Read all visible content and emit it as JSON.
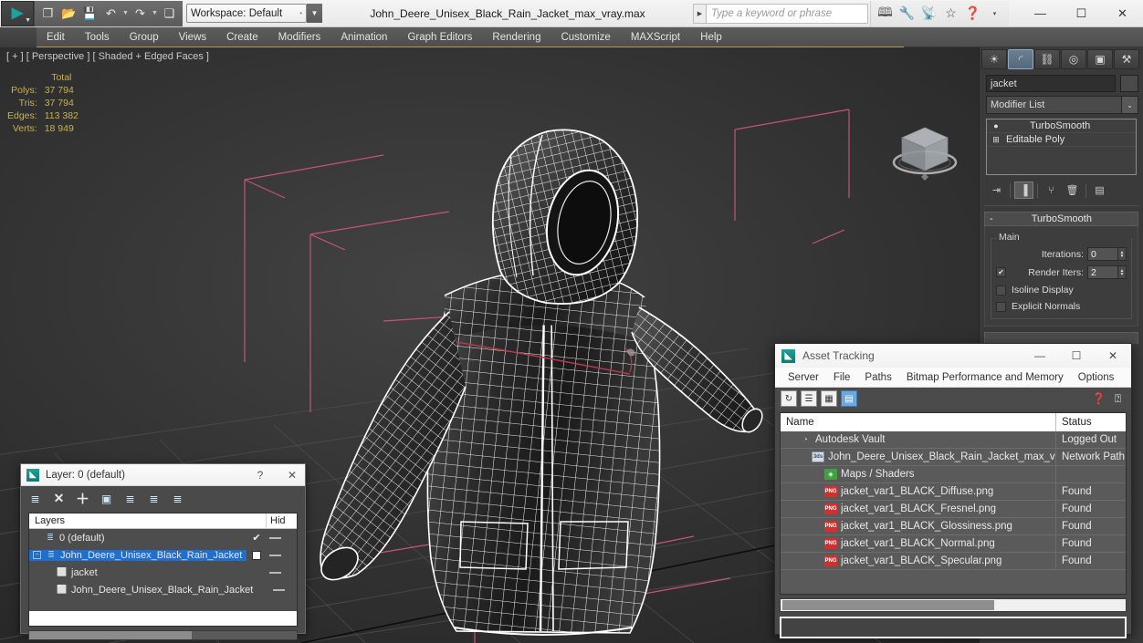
{
  "titlebar": {
    "logo_glyph": "▶",
    "quick_access": [
      {
        "name": "new-file-icon",
        "glyph": "❐"
      },
      {
        "name": "open-file-icon",
        "glyph": "📂"
      },
      {
        "name": "save-file-icon",
        "glyph": "💾"
      },
      {
        "name": "undo-icon",
        "glyph": "↶"
      },
      {
        "name": "undo-dropdown-icon",
        "glyph": "▼"
      },
      {
        "name": "redo-icon",
        "glyph": "↷"
      },
      {
        "name": "redo-dropdown-icon",
        "glyph": "▼"
      },
      {
        "name": "project-folder-icon",
        "glyph": "❑"
      }
    ],
    "workspace_label": "Workspace: Default",
    "workspace_sep": "•",
    "workspace_dropdown": "▼",
    "document_title": "John_Deere_Unisex_Black_Rain_Jacket_max_vray.max",
    "search_arrow": "▶",
    "search_placeholder": "Type a keyword or phrase",
    "right_icons": [
      {
        "name": "binoculars-icon",
        "glyph": "🕮"
      },
      {
        "name": "wrench-icon",
        "glyph": "🔧"
      },
      {
        "name": "satellite-dish-icon",
        "glyph": "📡"
      },
      {
        "name": "star-icon",
        "glyph": "☆"
      },
      {
        "name": "help-icon",
        "glyph": "❓"
      },
      {
        "name": "help-dropdown-icon",
        "glyph": "▾"
      }
    ],
    "window_buttons": [
      {
        "name": "minimize-button",
        "glyph": "—"
      },
      {
        "name": "maximize-button",
        "glyph": "☐"
      },
      {
        "name": "close-button",
        "glyph": "✕"
      }
    ]
  },
  "menubar": {
    "items": [
      "Edit",
      "Tools",
      "Group",
      "Views",
      "Create",
      "Modifiers",
      "Animation",
      "Graph Editors",
      "Rendering",
      "Customize",
      "MAXScript",
      "Help"
    ]
  },
  "viewport": {
    "label": "[ + ] [ Perspective ] [ Shaded + Edged Faces ]",
    "stats": {
      "header": "Total",
      "rows": [
        {
          "key": "Polys:",
          "value": "37 794"
        },
        {
          "key": "Tris:",
          "value": "37 794"
        },
        {
          "key": "Edges:",
          "value": "113 382"
        },
        {
          "key": "Verts:",
          "value": "18 949"
        }
      ]
    },
    "colors": {
      "background": "#323232",
      "helper_lines": "#cc5577",
      "grid": "#4a4a4a",
      "wireframe": "#ffffff"
    }
  },
  "command_panel": {
    "tabs": [
      {
        "name": "create-tab",
        "glyph": "☀",
        "active": false
      },
      {
        "name": "modify-tab",
        "glyph": "◜",
        "active": true
      },
      {
        "name": "hierarchy-tab",
        "glyph": "⛓",
        "active": false
      },
      {
        "name": "motion-tab",
        "glyph": "◎",
        "active": false
      },
      {
        "name": "display-tab",
        "glyph": "▣",
        "active": false
      },
      {
        "name": "utilities-tab",
        "glyph": "⚒",
        "active": false
      }
    ],
    "object_name": "jacket",
    "modifier_list_label": "Modifier List",
    "modifier_list_arrow": "⌄",
    "modifier_stack": [
      {
        "label": "TurboSmooth",
        "icon": "lightbulb-icon",
        "glyph": "●"
      },
      {
        "label": "Editable Poly",
        "icon": "plus-box-icon",
        "glyph": "⊞"
      }
    ],
    "stack_tools": [
      {
        "name": "pin-stack-icon",
        "glyph": "⇥"
      },
      {
        "name": "show-end-result-icon",
        "glyph": "▐"
      },
      {
        "name": "make-unique-icon",
        "glyph": "⑂"
      },
      {
        "name": "remove-modifier-icon",
        "glyph": "🗑"
      },
      {
        "name": "configure-sets-icon",
        "glyph": "▤"
      }
    ],
    "rollout": {
      "collapse_glyph": "-",
      "title": "TurboSmooth",
      "group_title": "Main",
      "iterations_label": "Iterations:",
      "iterations_value": "0",
      "render_iters_label": "Render Iters:",
      "render_iters_value": "2",
      "render_iters_checked": "✔",
      "isoline_label": "Isoline Display",
      "explicit_normals_label": "Explicit Normals"
    }
  },
  "layer_dialog": {
    "title": "Layer: 0 (default)",
    "help_glyph": "?",
    "close_glyph": "✕",
    "toolbar": [
      {
        "name": "new-layer-icon",
        "glyph": "≣"
      },
      {
        "name": "delete-layer-icon",
        "glyph": "✕"
      },
      {
        "name": "add-layer-icon",
        "glyph": "＋"
      },
      {
        "name": "select-objects-in-layer-icon",
        "glyph": "▣"
      },
      {
        "name": "select-highlighted-objects-icon",
        "glyph": "≣"
      },
      {
        "name": "add-selection-to-layer-icon",
        "glyph": "≣"
      },
      {
        "name": "layer-settings-icon",
        "glyph": "≣"
      }
    ],
    "col_name": "Layers",
    "col_hide": "Hid",
    "rows": [
      {
        "label": "0 (default)",
        "indent": 1,
        "selected": false,
        "icon": "layer-icon",
        "glyph": "≣",
        "check": "✔",
        "box": false,
        "dash": true
      },
      {
        "label": "John_Deere_Unisex_Black_Rain_Jacket",
        "indent": 0,
        "selected": true,
        "icon": "layer-icon",
        "glyph": "≣",
        "check": "",
        "box": true,
        "dash": true,
        "expander": "−"
      },
      {
        "label": "jacket",
        "indent": 2,
        "selected": false,
        "icon": "object-icon",
        "glyph": "⬜",
        "check": "",
        "box": false,
        "dash": true
      },
      {
        "label": "John_Deere_Unisex_Black_Rain_Jacket",
        "indent": 2,
        "selected": false,
        "icon": "object-icon",
        "glyph": "⬜",
        "check": "",
        "box": false,
        "dash": true
      }
    ]
  },
  "asset_tracking": {
    "title": "Asset Tracking",
    "window_buttons": [
      {
        "name": "at-minimize-button",
        "glyph": "—"
      },
      {
        "name": "at-maximize-button",
        "glyph": "☐"
      },
      {
        "name": "at-close-button",
        "glyph": "✕"
      }
    ],
    "menu": [
      "Server",
      "File",
      "Paths",
      "Bitmap Performance and Memory",
      "Options"
    ],
    "toolbar": [
      {
        "name": "refresh-icon",
        "glyph": "↻",
        "selected": false
      },
      {
        "name": "list-view-icon",
        "glyph": "☰",
        "selected": false
      },
      {
        "name": "thumbnail-view-icon",
        "glyph": "▦",
        "selected": false
      },
      {
        "name": "grid-view-icon",
        "glyph": "▤",
        "selected": true
      }
    ],
    "help_icons": [
      {
        "name": "help-icon",
        "glyph": "❓"
      },
      {
        "name": "context-help-icon",
        "glyph": "⍰"
      }
    ],
    "columns": {
      "name": "Name",
      "status": "Status"
    },
    "rows": [
      {
        "name": "Autodesk Vault",
        "status": "Logged Out",
        "indent": 1,
        "icon": "vault-icon",
        "glyph": "◔",
        "icon_class": "vault"
      },
      {
        "name": "John_Deere_Unisex_Black_Rain_Jacket_max_vray…",
        "status": "Network Path",
        "indent": 2,
        "icon": "max-file-icon",
        "glyph": "3ds",
        "icon_class": "max"
      },
      {
        "name": "Maps / Shaders",
        "status": "",
        "indent": 3,
        "icon": "maps-shaders-icon",
        "glyph": "◈",
        "icon_class": "maps"
      },
      {
        "name": "jacket_var1_BLACK_Diffuse.png",
        "status": "Found",
        "indent": 3,
        "icon": "png-file-icon",
        "glyph": "PNG",
        "icon_class": "png"
      },
      {
        "name": "jacket_var1_BLACK_Fresnel.png",
        "status": "Found",
        "indent": 3,
        "icon": "png-file-icon",
        "glyph": "PNG",
        "icon_class": "png"
      },
      {
        "name": "jacket_var1_BLACK_Glossiness.png",
        "status": "Found",
        "indent": 3,
        "icon": "png-file-icon",
        "glyph": "PNG",
        "icon_class": "png"
      },
      {
        "name": "jacket_var1_BLACK_Normal.png",
        "status": "Found",
        "indent": 3,
        "icon": "png-file-icon",
        "glyph": "PNG",
        "icon_class": "png"
      },
      {
        "name": "jacket_var1_BLACK_Specular.png",
        "status": "Found",
        "indent": 3,
        "icon": "png-file-icon",
        "glyph": "PNG",
        "icon_class": "png"
      }
    ]
  }
}
